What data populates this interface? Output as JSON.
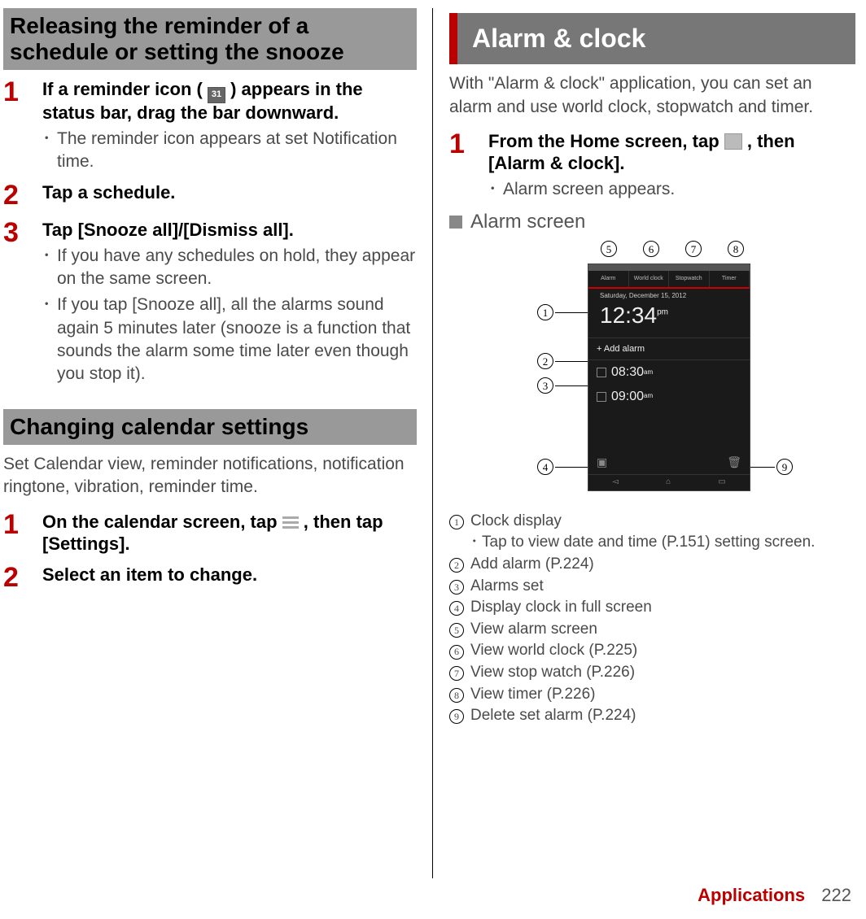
{
  "left": {
    "heading1": "Releasing the reminder of a schedule or setting the snooze",
    "step1": {
      "title_a": "If a reminder icon (",
      "title_b": ") appears in the status bar, drag the bar downward.",
      "icon_label": "31",
      "bullet1": "The reminder icon appears at set Notification time."
    },
    "step2": {
      "title": "Tap a schedule."
    },
    "step3": {
      "title": "Tap [Snooze all]/[Dismiss all].",
      "bullet1": "If you have any schedules on hold, they appear on the same screen.",
      "bullet2": "If you tap [Snooze all], all the alarms sound again 5 minutes later (snooze is a function that sounds the alarm some time later even though you stop it)."
    },
    "heading2": "Changing calendar settings",
    "body2": "Set Calendar view, reminder notifications, notification ringtone, vibration, reminder time.",
    "step_b1": {
      "title_a": "On the calendar screen, tap ",
      "title_b": ", then tap [Settings]."
    },
    "step_b2": {
      "title": "Select an item to change."
    }
  },
  "right": {
    "section_title": "Alarm & clock",
    "intro": "With \"Alarm & clock\" application, you can set an alarm and use world clock, stopwatch and timer.",
    "step1": {
      "title_a": "From the Home screen, tap ",
      "title_b": ", then [Alarm & clock].",
      "bullet1": "Alarm screen appears."
    },
    "sub_heading": "Alarm screen",
    "phone": {
      "tabs": [
        "Alarm",
        "World clock",
        "Stopwatch",
        "Timer"
      ],
      "date": "Saturday, December 15, 2012",
      "time": "12:34",
      "ampm": "pm",
      "add": "+ Add alarm",
      "alarm1": "08:30",
      "alarm1_sfx": "am",
      "alarm2": "09:00",
      "alarm2_sfx": "am"
    },
    "callouts": {
      "c1": "1",
      "c2": "2",
      "c3": "3",
      "c4": "4",
      "c5": "5",
      "c6": "6",
      "c7": "7",
      "c8": "8",
      "c9": "9"
    },
    "legend": {
      "l1": "Clock display",
      "l1_sub": "Tap to view date and time (P.151) setting screen.",
      "l2": "Add alarm (P.224)",
      "l3": "Alarms set",
      "l4": "Display clock in full screen",
      "l5": "View alarm screen",
      "l6": "View world clock (P.225)",
      "l7": "View stop watch (P.226)",
      "l8": "View timer (P.226)",
      "l9": "Delete set alarm (P.224)"
    }
  },
  "footer": {
    "section": "Applications",
    "page": "222"
  }
}
